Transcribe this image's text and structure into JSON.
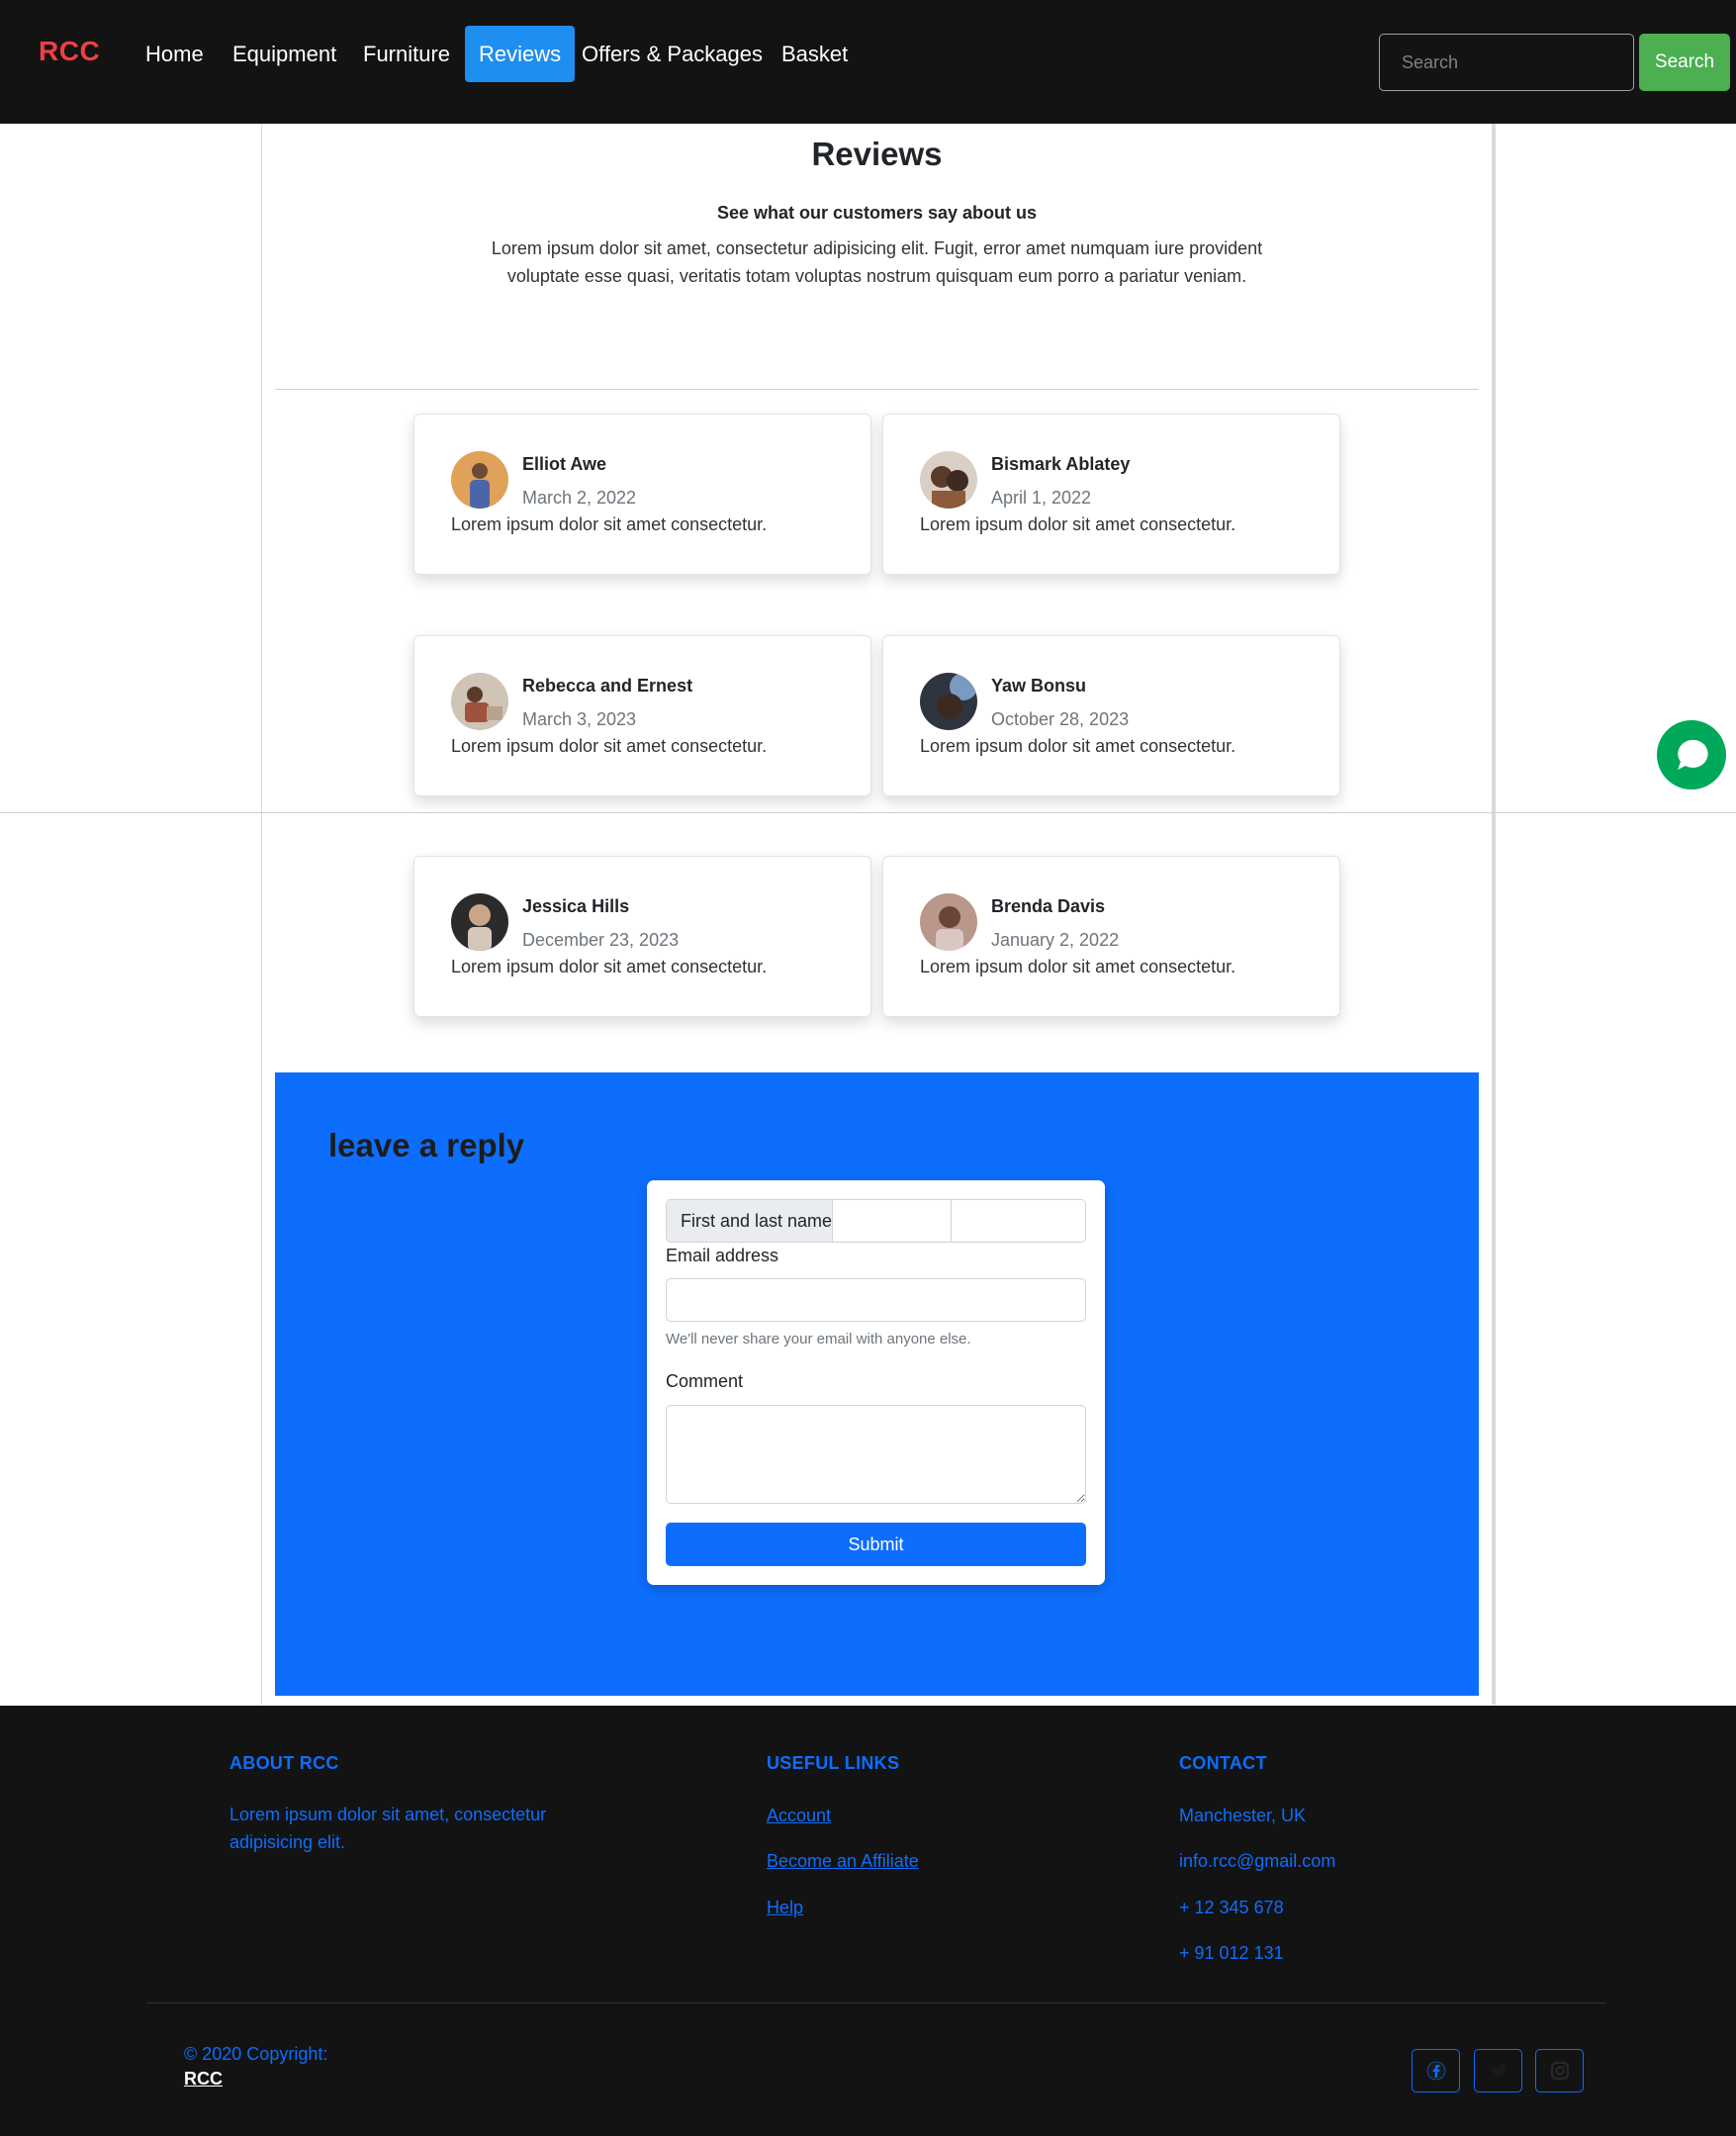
{
  "navbar": {
    "brand": "RCC",
    "items": [
      {
        "label": "Home"
      },
      {
        "label": "Equipment"
      },
      {
        "label": "Furniture"
      },
      {
        "label": "Reviews",
        "active": true
      },
      {
        "label": "Offers & Packages"
      },
      {
        "label": "Basket"
      }
    ],
    "search_placeholder": "Search",
    "search_button": "Search"
  },
  "header": {
    "title": "Reviews",
    "subtitle": "See what our customers say about us",
    "intro": "Lorem ipsum dolor sit amet, consectetur adipisicing elit. Fugit, error amet numquam iure provident voluptate esse quasi, veritatis totam voluptas nostrum quisquam eum porro a pariatur veniam."
  },
  "reviews": [
    {
      "name": "Elliot Awe",
      "date": "March 2, 2022",
      "text": "Lorem ipsum dolor sit amet consectetur."
    },
    {
      "name": "Bismark Ablatey",
      "date": "April 1, 2022",
      "text": "Lorem ipsum dolor sit amet consectetur."
    },
    {
      "name": "Rebecca and Ernest",
      "date": "March 3, 2023",
      "text": "Lorem ipsum dolor sit amet consectetur."
    },
    {
      "name": "Yaw Bonsu",
      "date": "October 28, 2023",
      "text": "Lorem ipsum dolor sit amet consectetur."
    },
    {
      "name": "Jessica Hills",
      "date": "December 23, 2023",
      "text": "Lorem ipsum dolor sit amet consectetur."
    },
    {
      "name": "Brenda Davis",
      "date": "January 2, 2022",
      "text": "Lorem ipsum dolor sit amet consectetur."
    }
  ],
  "reply": {
    "heading": "leave a reply",
    "name_label": "First and last name",
    "email_label": "Email address",
    "email_help": "We'll never share your email with anyone else.",
    "comment_label": "Comment",
    "submit": "Submit"
  },
  "footer": {
    "about": {
      "heading": "ABOUT RCC",
      "text": "Lorem ipsum dolor sit amet, consectetur adipisicing elit."
    },
    "links": {
      "heading": "USEFUL LINKS",
      "items": [
        "Account",
        "Become an Affiliate",
        "Help"
      ]
    },
    "contact": {
      "heading": "CONTACT",
      "items": [
        "Manchester, UK",
        "info.rcc@gmail.com",
        "+ 12 345 678",
        "+ 91 012 131"
      ]
    },
    "copyright": "© 2020 Copyright:",
    "copyright_brand": "RCC",
    "social": [
      "facebook-icon",
      "twitter-icon",
      "instagram-icon"
    ]
  },
  "colors": {
    "navbar_bg": "#131313",
    "brand": "#ee3f45",
    "active_tab": "#1f8ef1",
    "search_button": "#4caf50",
    "primary": "#0d6efd",
    "chat": "#00a85a"
  }
}
